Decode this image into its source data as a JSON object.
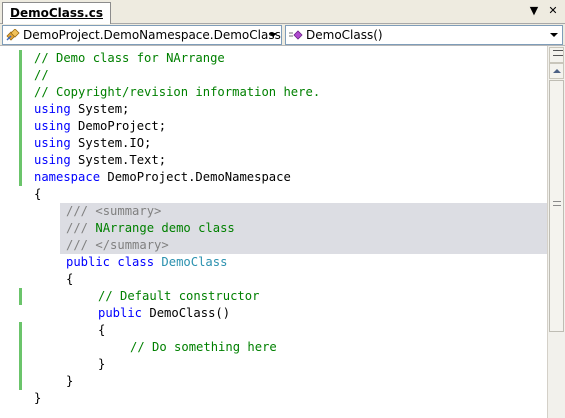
{
  "tab": {
    "title": "DemoClass.cs",
    "dropdown_glyph": "▼",
    "close_glyph": "✕"
  },
  "navigation": {
    "type_combo": {
      "value": "DemoProject.DemoNamespace.DemoClass",
      "icon": "class-icon"
    },
    "member_combo": {
      "value": "DemoClass()",
      "icon": "method-icon"
    }
  },
  "code": {
    "lines": [
      {
        "indent": 0,
        "spans": [
          {
            "t": "// Demo class for NArrange",
            "c": "c"
          }
        ]
      },
      {
        "indent": 0,
        "spans": [
          {
            "t": "//",
            "c": "c"
          }
        ]
      },
      {
        "indent": 0,
        "spans": [
          {
            "t": "// Copyright/revision information here.",
            "c": "c"
          }
        ]
      },
      {
        "indent": 0,
        "spans": [
          {
            "t": "using",
            "c": "k"
          },
          {
            "t": " System;",
            "c": ""
          }
        ]
      },
      {
        "indent": 0,
        "spans": [
          {
            "t": "using",
            "c": "k"
          },
          {
            "t": " DemoProject;",
            "c": ""
          }
        ]
      },
      {
        "indent": 0,
        "spans": [
          {
            "t": "using",
            "c": "k"
          },
          {
            "t": " System.IO;",
            "c": ""
          }
        ]
      },
      {
        "indent": 0,
        "spans": [
          {
            "t": "using",
            "c": "k"
          },
          {
            "t": " System.Text;",
            "c": ""
          }
        ]
      },
      {
        "indent": 0,
        "spans": [
          {
            "t": "namespace",
            "c": "k"
          },
          {
            "t": " DemoProject.DemoNamespace",
            "c": ""
          }
        ]
      },
      {
        "indent": 0,
        "spans": [
          {
            "t": "{",
            "c": ""
          }
        ]
      },
      {
        "indent": 1,
        "spans": [
          {
            "t": "///",
            "c": "g"
          },
          {
            "t": " ",
            "c": "c"
          },
          {
            "t": "<summary>",
            "c": "g"
          }
        ]
      },
      {
        "indent": 1,
        "spans": [
          {
            "t": "///",
            "c": "g"
          },
          {
            "t": " NArrange demo class",
            "c": "c"
          }
        ]
      },
      {
        "indent": 1,
        "spans": [
          {
            "t": "///",
            "c": "g"
          },
          {
            "t": " ",
            "c": "c"
          },
          {
            "t": "</summary>",
            "c": "g"
          }
        ]
      },
      {
        "indent": 1,
        "spans": [
          {
            "t": "public",
            "c": "k"
          },
          {
            "t": " ",
            "c": ""
          },
          {
            "t": "class",
            "c": "k"
          },
          {
            "t": " ",
            "c": ""
          },
          {
            "t": "DemoClass",
            "c": "t2"
          }
        ]
      },
      {
        "indent": 1,
        "spans": [
          {
            "t": "{",
            "c": ""
          }
        ]
      },
      {
        "indent": 2,
        "spans": [
          {
            "t": "// Default constructor",
            "c": "c"
          }
        ]
      },
      {
        "indent": 2,
        "spans": [
          {
            "t": "public",
            "c": "k"
          },
          {
            "t": " DemoClass()",
            "c": ""
          }
        ]
      },
      {
        "indent": 2,
        "spans": [
          {
            "t": "{",
            "c": ""
          }
        ]
      },
      {
        "indent": 3,
        "spans": [
          {
            "t": "// Do something here",
            "c": "c"
          }
        ]
      },
      {
        "indent": 2,
        "spans": [
          {
            "t": "}",
            "c": ""
          }
        ]
      },
      {
        "indent": 1,
        "spans": [
          {
            "t": "}",
            "c": ""
          }
        ]
      },
      {
        "indent": 0,
        "spans": [
          {
            "t": "}",
            "c": ""
          }
        ]
      }
    ],
    "changed_line_ranges": [
      [
        0,
        7
      ],
      [
        14,
        14
      ],
      [
        16,
        19
      ]
    ],
    "summary_highlight_lines": [
      9,
      11
    ]
  },
  "colors": {
    "comment": "#008000",
    "keyword": "#0000ff",
    "type": "#2b91af",
    "doc_tag": "#808080",
    "change_bar": "#6bc46b",
    "highlight_bg": "#dcdde3"
  }
}
